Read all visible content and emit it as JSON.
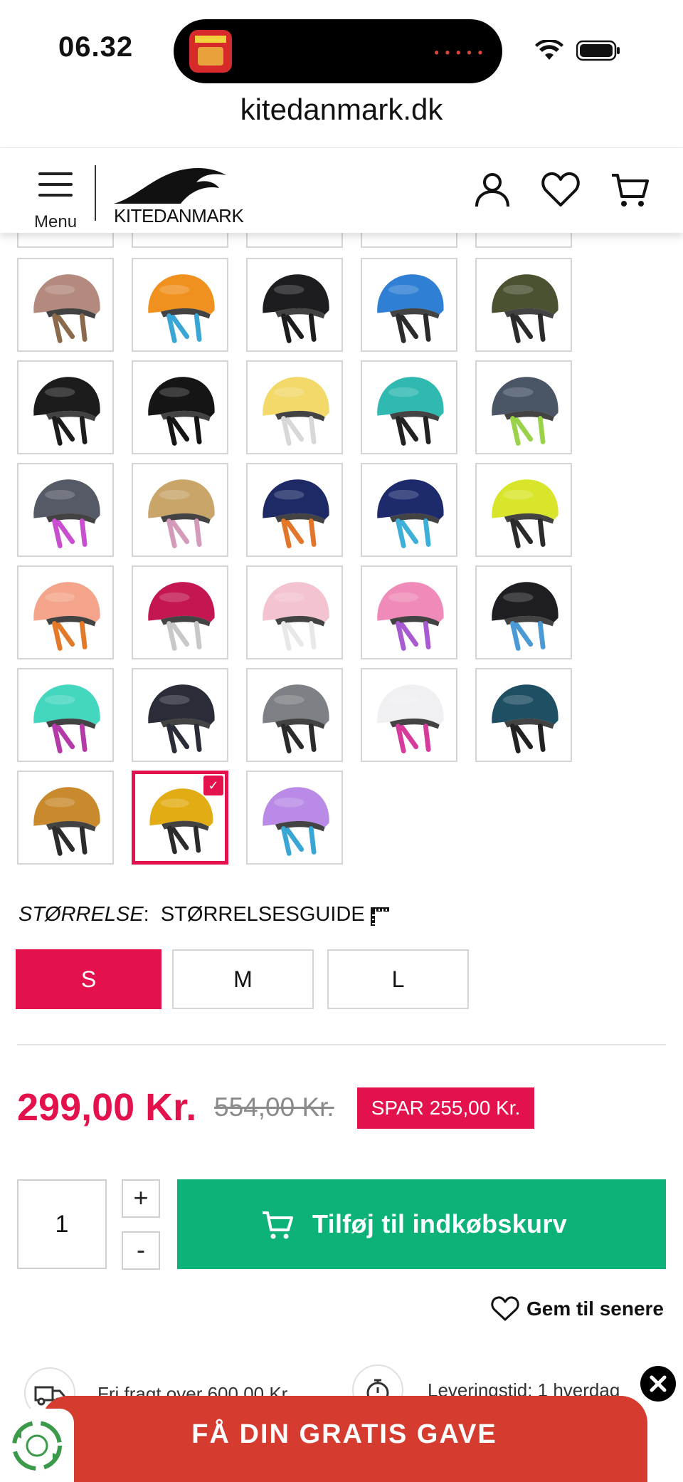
{
  "status_bar": {
    "time": "06.32"
  },
  "browser": {
    "url": "kitedanmark.dk"
  },
  "header": {
    "menu_label": "Menu",
    "logo_text": "KITEDANMARK"
  },
  "swatches": [
    {
      "name": "rose-tan",
      "shell": "#b48a7e",
      "strap": "#8a6a4a"
    },
    {
      "name": "orange-blue",
      "shell": "#f0901e",
      "strap": "#3aa6d6"
    },
    {
      "name": "black-print",
      "shell": "#1d1d1f",
      "strap": "#1d1d1f"
    },
    {
      "name": "blue",
      "shell": "#2f7fd4",
      "strap": "#2b2b2b"
    },
    {
      "name": "olive",
      "shell": "#4b5232",
      "strap": "#2b2b2b"
    },
    {
      "name": "black-skull",
      "shell": "#1c1c1c",
      "strap": "#1c1c1c"
    },
    {
      "name": "black-gold",
      "shell": "#151515",
      "strap": "#151515"
    },
    {
      "name": "yellow",
      "shell": "#f3d86a",
      "strap": "#d8d8d8"
    },
    {
      "name": "teal-pattern",
      "shell": "#2fb9b0",
      "strap": "#222222"
    },
    {
      "name": "granite-lime",
      "shell": "#4a5566",
      "strap": "#9ad24a"
    },
    {
      "name": "granite-pink",
      "shell": "#565a66",
      "strap": "#c94fd1"
    },
    {
      "name": "gradient-gold-pink",
      "shell": "#c9a56a",
      "strap": "#d39ab9"
    },
    {
      "name": "navy-orange",
      "shell": "#1e2a66",
      "strap": "#e2762a"
    },
    {
      "name": "navy-blue",
      "shell": "#1d2a6c",
      "strap": "#3cb0d8"
    },
    {
      "name": "lime",
      "shell": "#d8e52a",
      "strap": "#2b2b2b"
    },
    {
      "name": "peach-orange",
      "shell": "#f4a48a",
      "strap": "#e27a2a"
    },
    {
      "name": "raspberry",
      "shell": "#c41650",
      "strap": "#c8c8c8"
    },
    {
      "name": "light-pink",
      "shell": "#f3c3d0",
      "strap": "#e8e8e8"
    },
    {
      "name": "pink-purple",
      "shell": "#f08ab8",
      "strap": "#a85ad0"
    },
    {
      "name": "black-blue",
      "shell": "#1e1e22",
      "strap": "#4a9ad6"
    },
    {
      "name": "mint-magenta",
      "shell": "#43d7c0",
      "strap": "#b43aa8"
    },
    {
      "name": "eight-ball",
      "shell": "#2a2d38",
      "strap": "#2a2d38"
    },
    {
      "name": "grey",
      "shell": "#7d8084",
      "strap": "#2b2b2b"
    },
    {
      "name": "white-flower",
      "shell": "#f0f0f2",
      "strap": "#d63a9a"
    },
    {
      "name": "petrol",
      "shell": "#1f4f63",
      "strap": "#222222"
    },
    {
      "name": "leopard",
      "shell": "#c98a2e",
      "strap": "#2b2b2b"
    },
    {
      "name": "gold",
      "shell": "#e2ac14",
      "strap": "#2b2b2b",
      "selected": true
    },
    {
      "name": "gradient-pink-blue",
      "shell": "#b98ae6",
      "strap": "#3aa6d6"
    }
  ],
  "size": {
    "label": "STØRRELSE",
    "guide": "STØRRELSESGUIDE",
    "options": [
      "S",
      "M",
      "L"
    ],
    "selected": "S"
  },
  "price": {
    "current": "299,00 Kr.",
    "old": "554,00 Kr.",
    "save": "SPAR 255,00 Kr."
  },
  "cart": {
    "quantity": "1",
    "plus": "+",
    "minus": "-",
    "add_label": "Tilføj til indkøbskurv",
    "save_later": "Gem til senere"
  },
  "usp": {
    "shipping": "Fri fragt over 600,00 Kr.",
    "delivery": "Leveringstid: 1 hverdag"
  },
  "banner": {
    "label": "FÅ DIN GRATIS GAVE"
  },
  "colors": {
    "brand_red": "#e4124c",
    "cart_green": "#0cb277",
    "banner_red": "#d63b2f"
  }
}
